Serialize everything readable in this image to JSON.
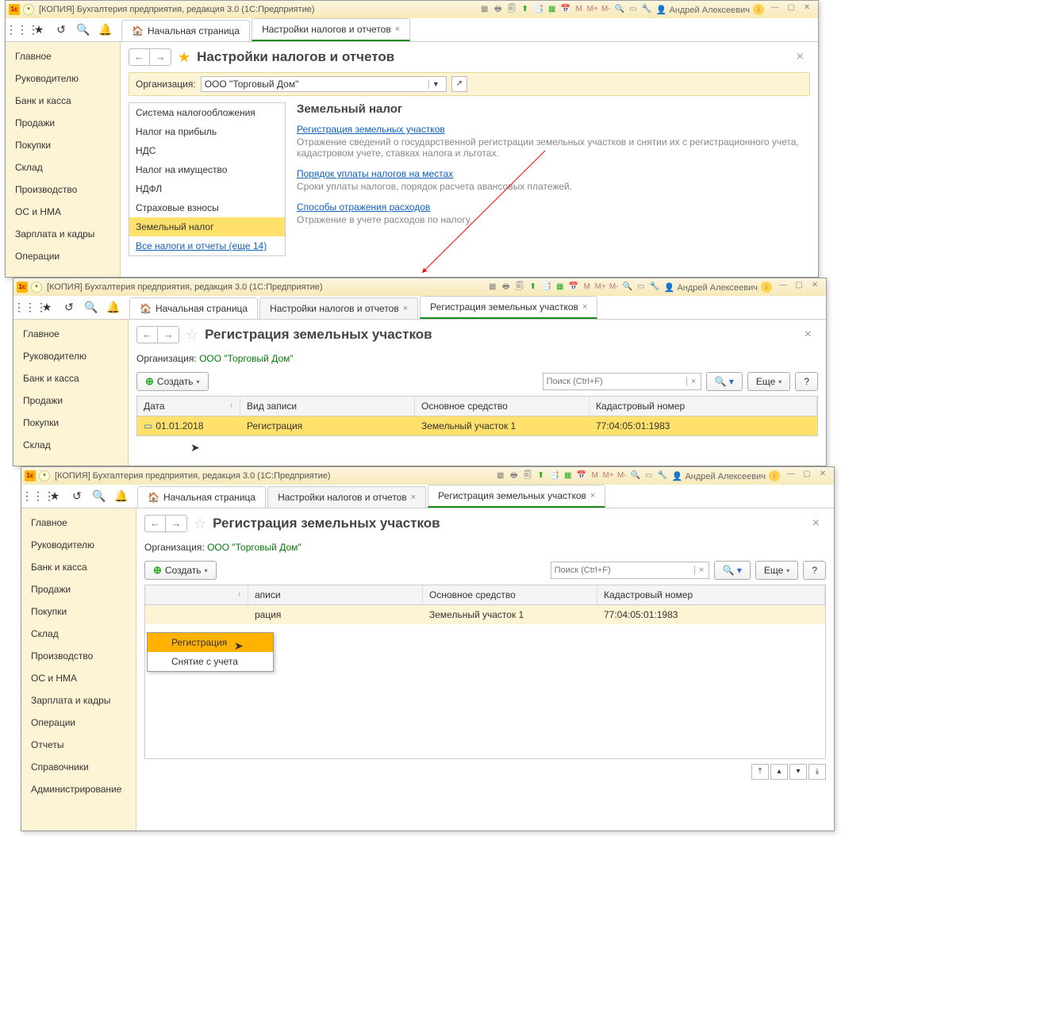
{
  "app_title": "[КОПИЯ] Бухгалтерия предприятия, редакция 3.0  (1С:Предприятие)",
  "user_name": "Андрей Алексеевич",
  "tb_m": [
    "M",
    "M+",
    "M-"
  ],
  "nav_home": "Начальная страница",
  "tabs": {
    "settings": "Настройки налогов и отчетов",
    "register": "Регистрация земельных участков"
  },
  "sidebar": {
    "items": [
      "Главное",
      "Руководителю",
      "Банк и касса",
      "Продажи",
      "Покупки",
      "Склад",
      "Производство",
      "ОС и НМА",
      "Зарплата и кадры",
      "Операции",
      "Отчеты",
      "Справочники",
      "Администрирование"
    ]
  },
  "page1": {
    "title": "Настройки налогов и отчетов",
    "org_label": "Организация:",
    "org_value": "ООО \"Торговый Дом\"",
    "sections": [
      "Система налогообложения",
      "Налог на прибыль",
      "НДС",
      "Налог на имущество",
      "НДФЛ",
      "Страховые взносы",
      "Земельный налог"
    ],
    "all_link": "Все налоги и отчеты (еще 14)",
    "body_title": "Земельный налог",
    "link1": "Регистрация земельных участков",
    "desc1": "Отражение сведений о государственной регистрации земельных участков и снятии их с регистрационного учета, кадастровом учете, ставках налога и льготах.",
    "link2": "Порядок уплаты налогов на местах",
    "desc2": "Сроки уплаты налогов, порядок расчета авансовых платежей.",
    "link3": "Способы отражения расходов",
    "desc3": "Отражение в учете расходов по налогу."
  },
  "page2": {
    "title": "Регистрация земельных участков",
    "org_label": "Организация:",
    "org_value": "ООО \"Торговый Дом\"",
    "create_btn": "Создать",
    "search_ph": "Поиск (Ctrl+F)",
    "more_btn": "Еще",
    "help_btn": "?",
    "cols": {
      "date": "Дата",
      "type": "Вид записи",
      "asset": "Основное средство",
      "cad": "Кадастровый номер"
    },
    "row": {
      "date": "01.01.2018",
      "type": "Регистрация",
      "asset": "Земельный участок 1",
      "cad": "77:04:05:01:1983"
    }
  },
  "page3": {
    "menu": {
      "opt1": "Регистрация",
      "opt2": "Снятие с учета"
    }
  }
}
